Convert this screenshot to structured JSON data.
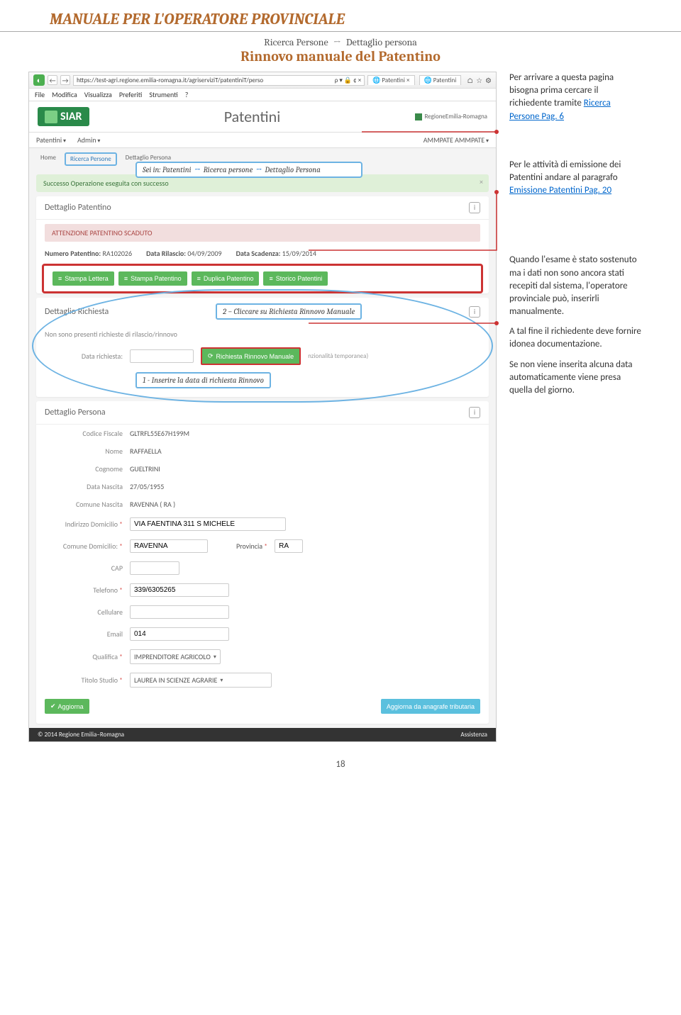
{
  "docHeader": "MANUALE PER L'OPERATORE PROVINCIALE",
  "crumb1": "Ricerca Persone",
  "crumb2": "Dettaglio persona",
  "title2": "Rinnovo manuale del Patentino",
  "side": {
    "p1": "Per arrivare a questa pagina bisogna prima cercare il richiedente tramite",
    "link1": "Ricerca Persone Pag. 6",
    "p2": "Per le attività di emissione dei Patentini andare al paragrafo",
    "link2": "Emissione Patentini Pag. 20",
    "p3": "Quando l'esame è stato sostenuto ma i dati non sono ancora stati recepiti dal sistema, l'operatore provinciale può, inserirli manualmente.",
    "p4": "A tal fine il richiedente deve fornire idonea documentazione.",
    "p5": "Se non viene inserita alcuna data automaticamente viene presa quella del giorno."
  },
  "annotBreadcrumb": {
    "prefix": "Sei in:  Patentini",
    "seg2": "Ricerca persone",
    "seg3": "Dettaglio Persona"
  },
  "annot2": "2 – Cliccare su Richiesta Rinnovo Manuale",
  "annot1": "1 - Inserire la data di richiesta Rinnovo",
  "browser": {
    "url": "https://test-agri.regione.emilia-romagna.it/agriserviziT/patentiniT/perso",
    "urlSuffix": "ρ ▾ 🔒 ¢ ×",
    "tab1": "Patentini",
    "tab2": "Patentini",
    "menu": [
      "File",
      "Modifica",
      "Visualizza",
      "Preferiti",
      "Strumenti",
      "?"
    ]
  },
  "app": {
    "logo": "SIAR",
    "title": "Patentini",
    "region": "RegioneEmilia-Romagna",
    "nav": {
      "patentini": "Patentini",
      "admin": "Admin",
      "user": "AMMPATE AMMPATE"
    },
    "crumbs": {
      "home": "Home",
      "ricerca": "Ricerca Persone",
      "dettaglio": "Dettaglio Persona"
    },
    "success": "Successo Operazione eseguita con successo",
    "dettaglioPatentino": "Dettaglio Patentino",
    "alert": "ATTENZIONE PATENTINO SCADUTO",
    "numLabel": "Numero Patentino:",
    "numVal": "RA102026",
    "rilLabel": "Data Rilascio:",
    "rilVal": "04/09/2009",
    "scadLabel": "Data Scadenza:",
    "scadVal": "15/09/2014",
    "btns": {
      "stampa": "Stampa  Lettera",
      "stampaP": "Stampa  Patentino",
      "duplica": "Duplica  Patentino",
      "storico": "Storico  Patentini"
    },
    "dettaglioRichiesta": "Dettaglio Richiesta",
    "noRichieste": "Non sono presenti richieste di rilascio/rinnovo",
    "dataRichiesta": "Data richiesta:",
    "rinnovoManuale": "Richiesta  Rinnovo  Manuale",
    "funzTemp": "nzionalità temporanea)",
    "dettaglioPersona": "Dettaglio Persona",
    "fields": {
      "cf": {
        "label": "Codice Fiscale",
        "value": "GLTRFL55E67H199M"
      },
      "nome": {
        "label": "Nome",
        "value": "RAFFAELLA"
      },
      "cognome": {
        "label": "Cognome",
        "value": "GUELTRINI"
      },
      "dnascita": {
        "label": "Data Nascita",
        "value": "27/05/1955"
      },
      "cnascita": {
        "label": "Comune Nascita",
        "value": "RAVENNA ( RA )"
      },
      "indirizzo": {
        "label": "Indirizzo Domicilio",
        "value": "VIA FAENTINA 311 S MICHELE"
      },
      "comuneDom": {
        "label": "Comune Domicilio:",
        "value": "RAVENNA"
      },
      "provincia": {
        "label": "Provincia",
        "value": "RA"
      },
      "cap": {
        "label": "CAP",
        "value": ""
      },
      "tel": {
        "label": "Telefono",
        "value": "339/6305265"
      },
      "cell": {
        "label": "Cellulare",
        "value": ""
      },
      "email": {
        "label": "Email",
        "value": "014"
      },
      "qualifica": {
        "label": "Qualifica",
        "value": "IMPRENDITORE AGRICOLO"
      },
      "titolo": {
        "label": "Titolo Studio",
        "value": "LAUREA IN SCIENZE AGRARIE"
      }
    },
    "aggiorna": "Aggiorna",
    "aggiornaAnagrafe": "Aggiorna  da  anagrafe  tributaria",
    "footerLeft": "© 2014 Regione Emilia–Romagna",
    "footerRight": "Assistenza"
  },
  "pageNum": "18"
}
